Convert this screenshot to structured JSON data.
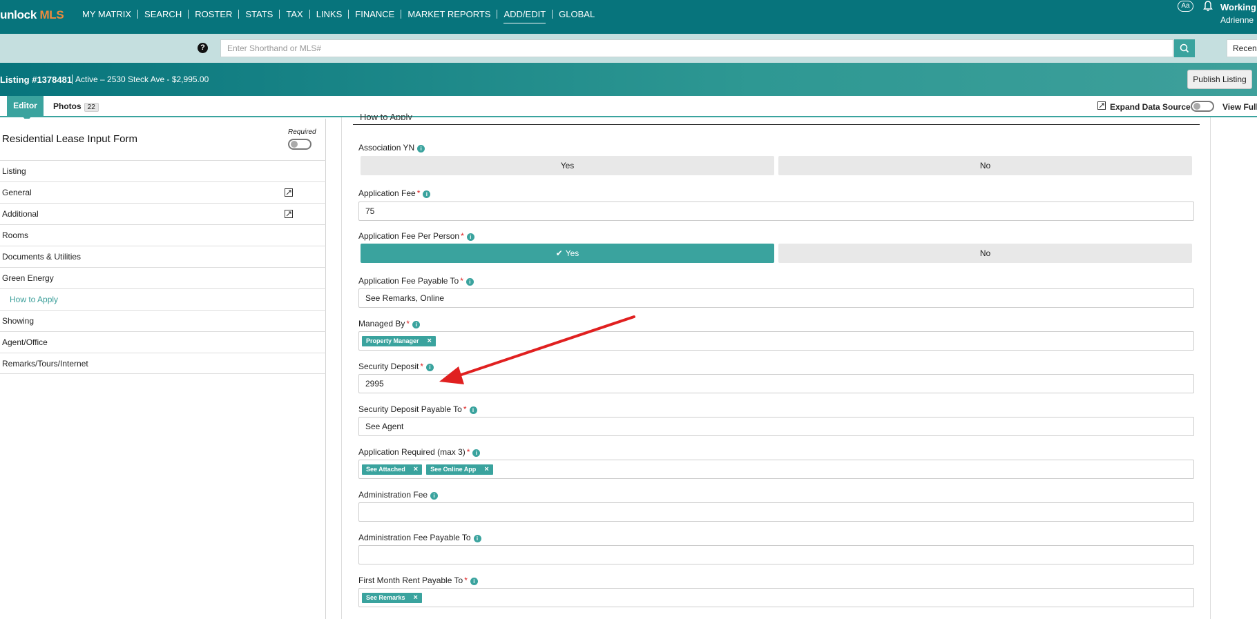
{
  "nav": {
    "logo_part1": "unlock",
    "logo_part2": "MLS",
    "links": [
      "MY MATRIX",
      "SEARCH",
      "ROSTER",
      "STATS",
      "TAX",
      "LINKS",
      "FINANCE",
      "MARKET REPORTS",
      "ADD/EDIT",
      "GLOBAL"
    ],
    "active_link": "ADD/EDIT",
    "font_button": "Aa",
    "user_status": "Working",
    "user_name": "Adrienne"
  },
  "search": {
    "placeholder": "Enter Shorthand or MLS#",
    "recent_label": "Recent"
  },
  "listing": {
    "id_label": "Listing #1378481",
    "status_line": "Active – 2530 Steck Ave - $2,995.00",
    "publish_label": "Publish Listing"
  },
  "tabs": {
    "editor": "Editor",
    "photos": "Photos",
    "photos_count": "22",
    "expand_label": "Expand Data Source",
    "view_full": "View Full"
  },
  "sidebar": {
    "title": "Residential Lease Input Form",
    "required_label": "Required",
    "items": [
      {
        "label": "Listing",
        "edit_icon": false
      },
      {
        "label": "General",
        "edit_icon": true
      },
      {
        "label": "Additional",
        "edit_icon": true
      },
      {
        "label": "Rooms",
        "edit_icon": false
      },
      {
        "label": "Documents & Utilities",
        "edit_icon": false
      },
      {
        "label": "Green Energy",
        "edit_icon": false
      },
      {
        "label": "How to Apply",
        "edit_icon": false,
        "active": true
      },
      {
        "label": "Showing",
        "edit_icon": false
      },
      {
        "label": "Agent/Office",
        "edit_icon": false
      },
      {
        "label": "Remarks/Tours/Internet",
        "edit_icon": false
      }
    ]
  },
  "form": {
    "section_title": "How to Apply",
    "association_yn": {
      "label": "Association YN",
      "yes": "Yes",
      "no": "No",
      "selected": "none"
    },
    "application_fee": {
      "label": "Application Fee",
      "value": "75"
    },
    "fee_per_person": {
      "label": "Application Fee Per Person",
      "yes": "Yes",
      "no": "No",
      "selected": "Yes"
    },
    "fee_payable_to": {
      "label": "Application Fee Payable To",
      "value": "See Remarks, Online"
    },
    "managed_by": {
      "label": "Managed By",
      "tags": [
        "Property Manager"
      ]
    },
    "security_deposit": {
      "label": "Security Deposit",
      "value": "2995"
    },
    "deposit_payable_to": {
      "label": "Security Deposit Payable To",
      "value": "See Agent"
    },
    "application_required": {
      "label": "Application Required (max 3)",
      "tags": [
        "See Attached",
        "See Online App"
      ]
    },
    "admin_fee": {
      "label": "Administration Fee",
      "value": ""
    },
    "admin_fee_payable_to": {
      "label": "Administration Fee Payable To",
      "value": ""
    },
    "first_month_payable_to": {
      "label": "First Month Rent Payable To",
      "tags": [
        "See Remarks"
      ]
    }
  },
  "colors": {
    "nav_bg": "#07747c",
    "accent": "#3aa39e",
    "logo_accent": "#f08a3c",
    "required_star": "#d22222",
    "annotation_arrow": "#e02020"
  }
}
